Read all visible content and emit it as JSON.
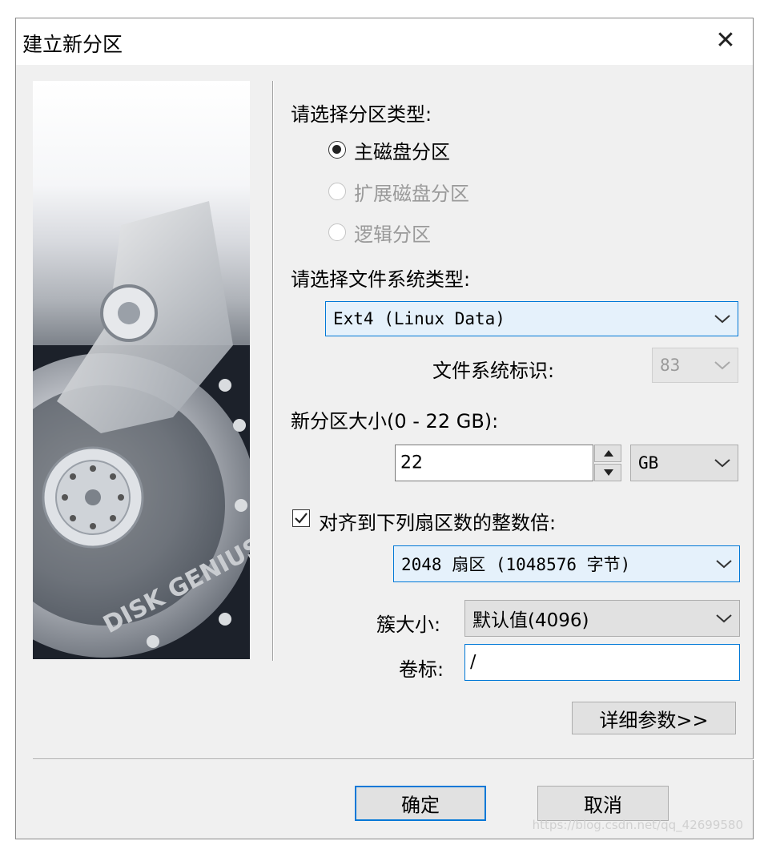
{
  "window": {
    "title": "建立新分区"
  },
  "partition_type": {
    "label": "请选择分区类型:",
    "options": [
      {
        "label": "主磁盘分区",
        "selected": true,
        "enabled": true
      },
      {
        "label": "扩展磁盘分区",
        "selected": false,
        "enabled": false
      },
      {
        "label": "逻辑分区",
        "selected": false,
        "enabled": false
      }
    ]
  },
  "filesystem": {
    "label": "请选择文件系统类型:",
    "value": "Ext4 (Linux Data)",
    "id_label": "文件系统标识:",
    "id_value": "83"
  },
  "size": {
    "label": "新分区大小(0 - 22 GB):",
    "value": "22",
    "unit": "GB"
  },
  "align": {
    "checked": true,
    "label": "对齐到下列扇区数的整数倍:",
    "value": "2048 扇区 (1048576 字节)"
  },
  "cluster": {
    "label": "簇大小:",
    "value": "默认值(4096)"
  },
  "volume": {
    "label": "卷标:",
    "value": "/"
  },
  "buttons": {
    "advanced": "详细参数>>",
    "ok": "确定",
    "cancel": "取消"
  },
  "image": {
    "brand_text": "DISK GENIUS"
  },
  "watermark": "https://blog.csdn.net/qq_42699580",
  "colors": {
    "accent": "#0078d7",
    "dialog_bg": "#f0f0f0"
  }
}
